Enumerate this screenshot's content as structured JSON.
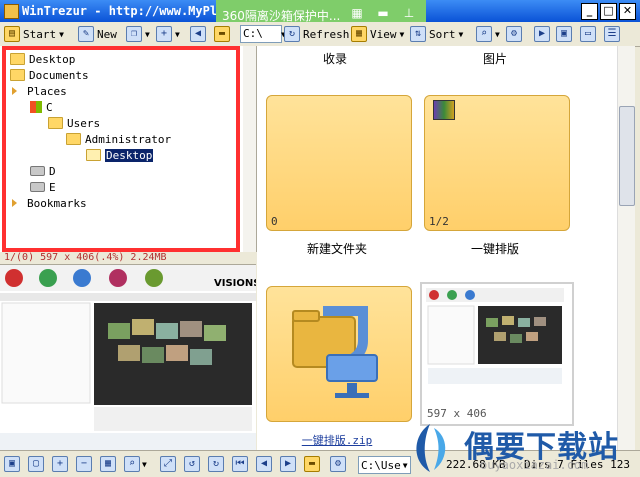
{
  "window": {
    "title": "WinTrezur - http://www.MyPla",
    "controls": [
      "_",
      "□",
      "✕"
    ]
  },
  "overlay_360": {
    "text": "360隔离沙箱保护中..."
  },
  "toolbar": {
    "start_label": "Start",
    "new_label": "New",
    "path_value": "C:\\",
    "refresh_label": "Refresh",
    "view_label": "View",
    "sort_label": "Sort"
  },
  "tree": {
    "items": [
      {
        "label": "Desktop",
        "icon": "folder-icon"
      },
      {
        "label": "Documents",
        "icon": "folder-icon"
      },
      {
        "label": "Places",
        "icon": "expand-arrow-icon"
      },
      {
        "label": "C",
        "icon": "windows-drive-icon"
      },
      {
        "label": "Users",
        "icon": "folder-icon"
      },
      {
        "label": "Administrator",
        "icon": "folder-icon"
      },
      {
        "label": "Desktop",
        "icon": "folder-icon",
        "selected": true
      },
      {
        "label": "D",
        "icon": "drive-icon"
      },
      {
        "label": "E",
        "icon": "drive-icon"
      },
      {
        "label": "Bookmarks",
        "icon": "expand-arrow-icon"
      }
    ]
  },
  "left_status": "1/(0) 597 x 406(.4%) 2.24MB",
  "preview": {
    "brand": "VISIONS"
  },
  "content": {
    "headers": [
      "收录",
      "图片"
    ],
    "tiles": [
      {
        "label": "新建文件夹",
        "count": "0"
      },
      {
        "label": "一键排版",
        "count": "1/2"
      },
      {
        "label": "一键排版.zip",
        "count": ""
      },
      {
        "label": "",
        "count": "",
        "dims": "597 x 406"
      }
    ]
  },
  "bottombar": {
    "path": "C:\\Use",
    "size": "222.68 KB",
    "summary": "Dirs 7 Files 123"
  },
  "watermark": {
    "text": "偶要下载站",
    "sub": "ouyaoxiazai.com"
  },
  "colors": {
    "titlebar": "#0a52d6",
    "overlay": "#7fcd6a",
    "highlight_frame": "#ff3030",
    "tile": "#ffd766",
    "selection": "#0a246a"
  }
}
